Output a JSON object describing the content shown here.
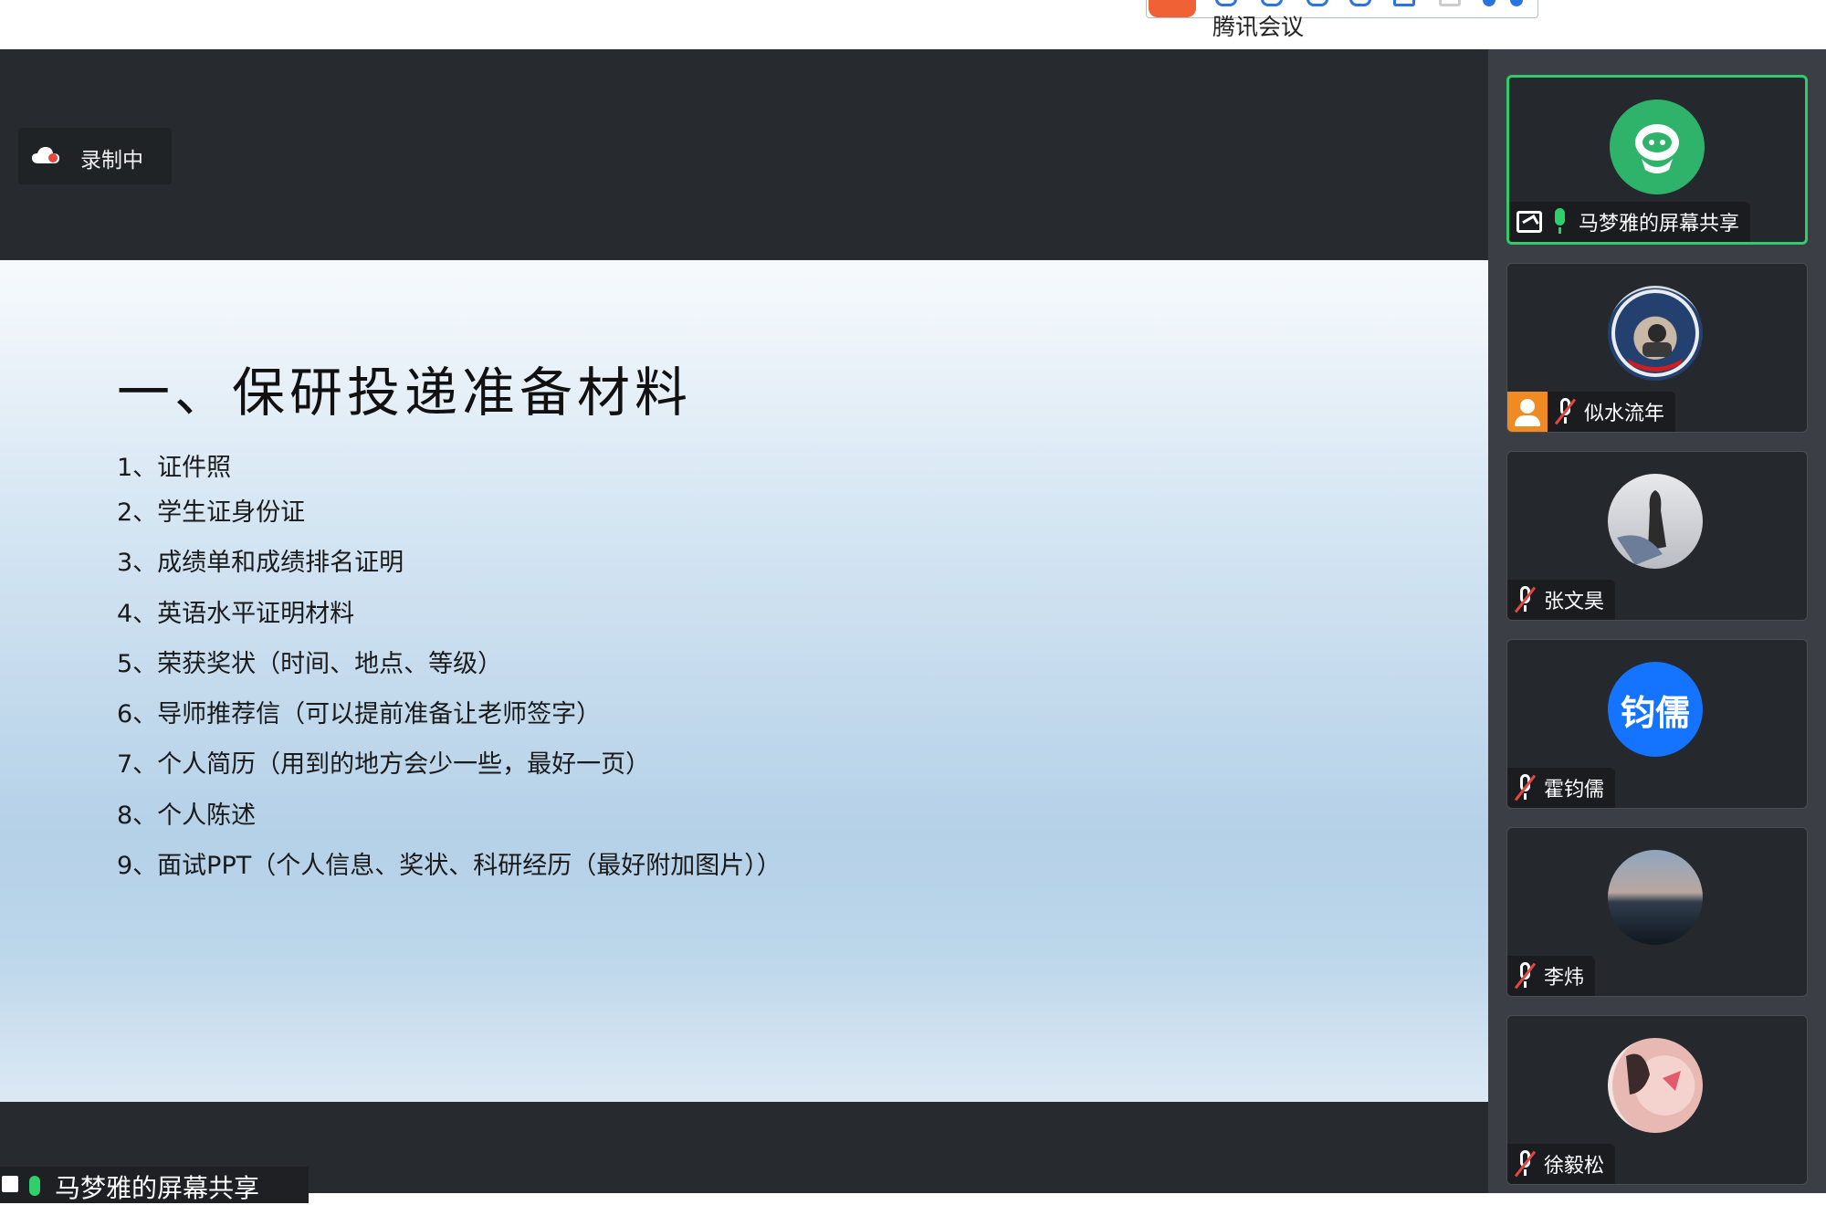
{
  "app": {
    "title": "腾讯会议",
    "recording_label": "录制中"
  },
  "slide": {
    "title": "一、保研投递准备材料",
    "items": [
      "1、证件照",
      "2、学生证身份证",
      "3、成绩单和成绩排名证明",
      "4、英语水平证明材料",
      "5、荣获奖状（时间、地点、等级）",
      "6、导师推荐信（可以提前准备让老师签字）",
      "7、个人简历（用到的地方会少一些，最好一页）",
      "8、个人陈述",
      "9、面试PPT（个人信息、奖状、科研经历（最好附加图片））"
    ]
  },
  "presenter_tag": "马梦雅的屏幕共享",
  "participants": [
    {
      "name": "马梦雅的屏幕共享",
      "mic": "on",
      "sharing": true,
      "active": true,
      "avatar": "robot-avatar"
    },
    {
      "name": "似水流年",
      "mic": "muted",
      "host": true,
      "avatar": "photo-avatar"
    },
    {
      "name": "张文昊",
      "mic": "muted",
      "avatar": "photo-avatar"
    },
    {
      "name": "霍钧儒",
      "mic": "muted",
      "avatar_text": "钧儒"
    },
    {
      "name": "李炜",
      "mic": "muted",
      "avatar": "landscape-avatar"
    },
    {
      "name": "徐毅松",
      "mic": "muted",
      "avatar": "photo-avatar"
    }
  ],
  "colors": {
    "stage_bg": "#272a2e",
    "sidebar_bg": "#3b3e44",
    "active_border": "#2fcc6e",
    "avatar_blue": "#1473ff",
    "host_orange": "#f08a22"
  }
}
